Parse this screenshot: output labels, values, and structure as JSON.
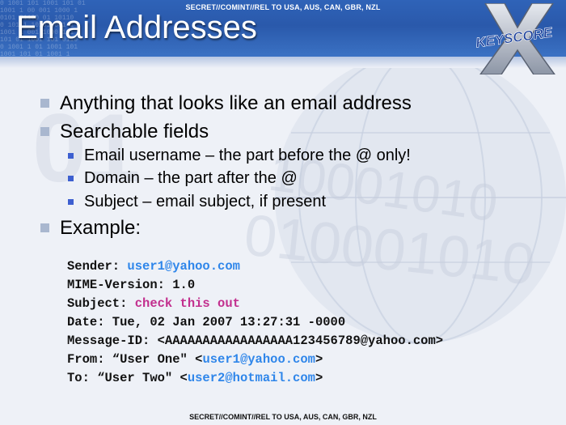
{
  "classification_top": "SECRET//COMINT//REL TO USA, AUS, CAN, GBR, NZL",
  "classification_bottom": "SECRET//COMINT//REL TO USA, AUS, CAN, GBR, NZL",
  "title": "Email Addresses",
  "logo_text": "KEYSCORE",
  "header_binary": "0 1001 101 1001 101 01\n1001 1 00 001 1000 1\n0101 01100 01 10110\n0 101 1 10101 001 1\n1001 1 001 1000 101\n101 01 1001 101 0110\n0 1001 1 01 1001 101\n1001 101 01 1001 1",
  "bullets": [
    {
      "text": "Anything that looks like an email address",
      "level": 1
    },
    {
      "text": "Searchable fields",
      "level": 1
    },
    {
      "text": "Email username – the part before the @ only!",
      "level": 2
    },
    {
      "text": "Domain – the part after the @",
      "level": 2
    },
    {
      "text": "Subject – email subject, if present",
      "level": 2
    },
    {
      "text": "Example:",
      "level": 1
    }
  ],
  "example": {
    "sender_label": "Sender: ",
    "sender_value": "user1@yahoo.com",
    "mime": "MIME-Version: 1.0",
    "subject_label": "Subject: ",
    "subject_value": "check this out",
    "date": "Date: Tue, 02 Jan 2007 13:27:31 -0000",
    "message_id": "Message-ID: <AAAAAAAAAAAAAAAAA123456789@yahoo.com>",
    "from_label": "From: “User One\" <",
    "from_value": "user1@yahoo.com",
    "from_end": ">",
    "to_label": "To: “User Two\" <",
    "to_value": "user2@hotmail.com",
    "to_end": ">"
  },
  "colors": {
    "header_blue": "#2f63b8",
    "bullet_square_l1": "#a9b7cf",
    "bullet_square_l2": "#3d5fd0",
    "email_blue": "#2f86ea",
    "subject_pink": "#c22f8e"
  },
  "icons": [
    "keyscore-logo",
    "globe-watermark",
    "binary-watermark"
  ]
}
